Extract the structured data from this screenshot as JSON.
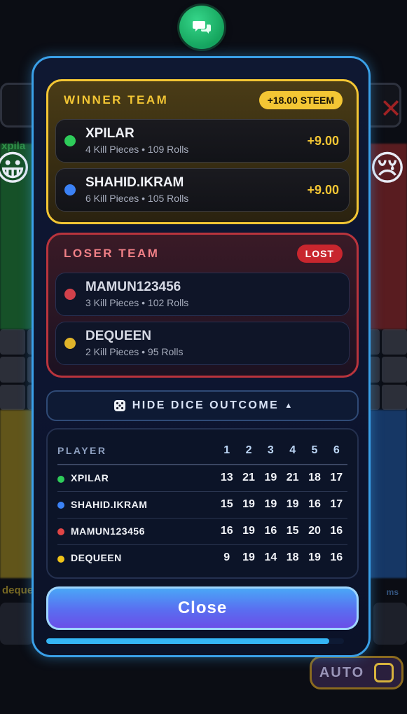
{
  "background": {
    "top_left_name": "xpila",
    "bottom_left_name": "deque",
    "bottom_right_name": "ms",
    "emoji_left": "😀",
    "emoji_right": "😢"
  },
  "auto": {
    "label": "AUTO"
  },
  "winner_team": {
    "title": "WINNER TEAM",
    "reward": "+18.00 STEEM",
    "players": [
      {
        "name": "XPILAR",
        "stats": "4 Kill Pieces • 109 Rolls",
        "score": "+9.00",
        "color": "#2ecc5a"
      },
      {
        "name": "SHAHID.IKRAM",
        "stats": "6 Kill Pieces • 105 Rolls",
        "score": "+9.00",
        "color": "#3b82f6"
      }
    ]
  },
  "loser_team": {
    "title": "LOSER TEAM",
    "badge": "LOST",
    "players": [
      {
        "name": "MAMUN123456",
        "stats": "3 Kill Pieces • 102 Rolls",
        "color": "#d2414b"
      },
      {
        "name": "DEQUEEN",
        "stats": "2 Kill Pieces • 95 Rolls",
        "color": "#e0b42a"
      }
    ]
  },
  "dice_toggle": {
    "label": "HIDE DICE OUTCOME",
    "icon": "dice-icon"
  },
  "dice_table": {
    "headers": [
      "PLAYER",
      "1",
      "2",
      "3",
      "4",
      "5",
      "6"
    ],
    "rows": [
      {
        "player": "XPILAR",
        "color": "#2ecc5a",
        "counts": [
          "13",
          "21",
          "19",
          "21",
          "18",
          "17"
        ]
      },
      {
        "player": "SHAHID.IKRAM",
        "color": "#3b82f6",
        "counts": [
          "15",
          "19",
          "19",
          "19",
          "16",
          "17"
        ]
      },
      {
        "player": "MAMUN123456",
        "color": "#e04545",
        "counts": [
          "16",
          "19",
          "16",
          "15",
          "20",
          "16"
        ]
      },
      {
        "player": "DEQUEEN",
        "color": "#f0c419",
        "counts": [
          "9",
          "19",
          "14",
          "18",
          "19",
          "16"
        ]
      }
    ]
  },
  "close_button": {
    "label": "Close"
  },
  "progress": {
    "fraction": 0.95
  }
}
